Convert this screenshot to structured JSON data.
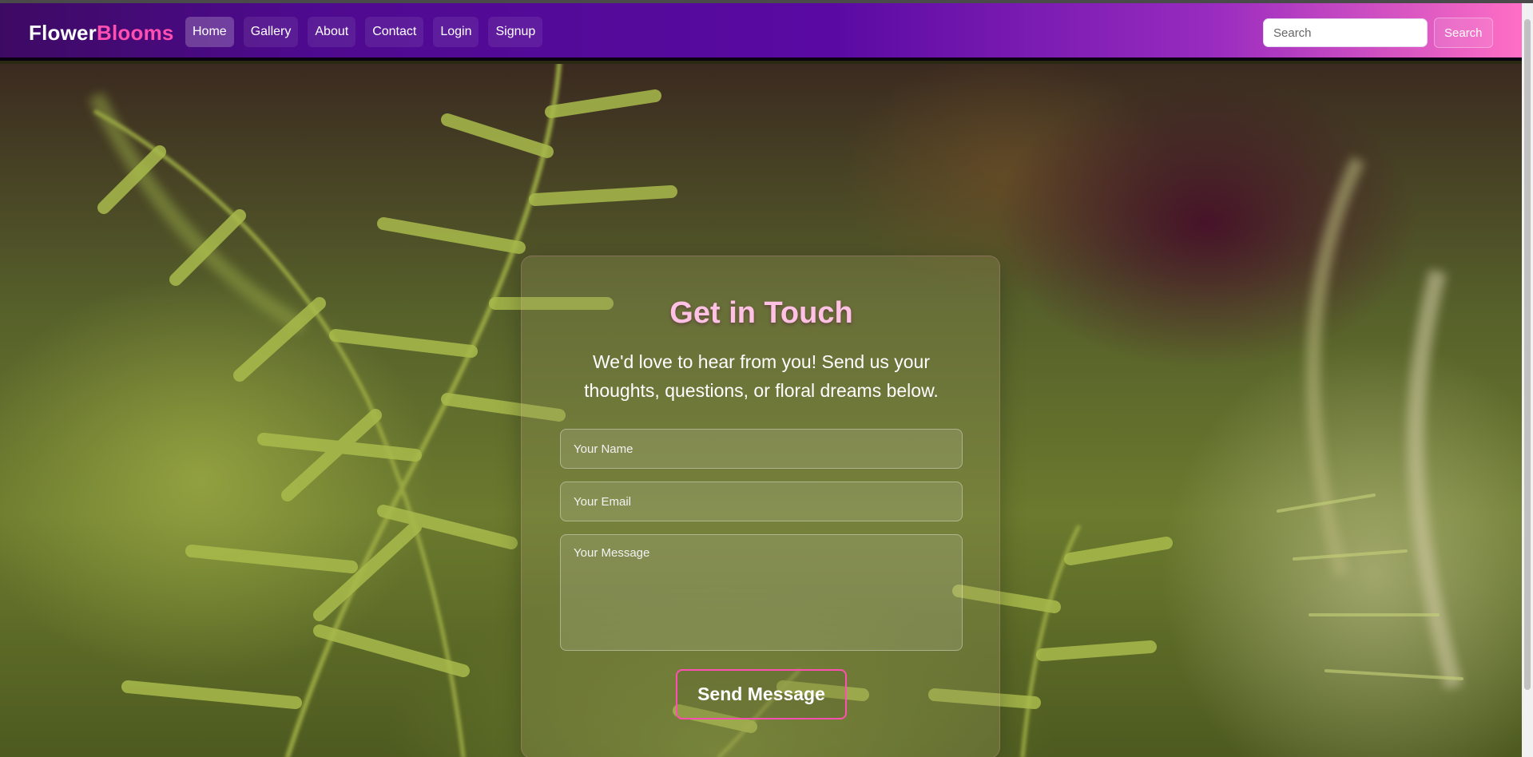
{
  "brand": {
    "part1": "Flower",
    "part2": "Blooms"
  },
  "nav": {
    "items": [
      "Home",
      "Gallery",
      "About",
      "Contact",
      "Login",
      "Signup"
    ],
    "active": "Home"
  },
  "search": {
    "placeholder": "Search",
    "button_label": "Search"
  },
  "contact": {
    "title": "Get in Touch",
    "text": "We'd love to hear from you! Send us your thoughts, questions, or floral dreams below.",
    "name_placeholder": "Your Name",
    "email_placeholder": "Your Email",
    "message_placeholder": "Your Message",
    "submit_label": "Send Message"
  },
  "colors": {
    "brand_accent": "#ff4fb0",
    "title": "#ffc2e4",
    "nav_gradient_start": "#3d0a63",
    "nav_gradient_end": "#ff6fc4"
  }
}
